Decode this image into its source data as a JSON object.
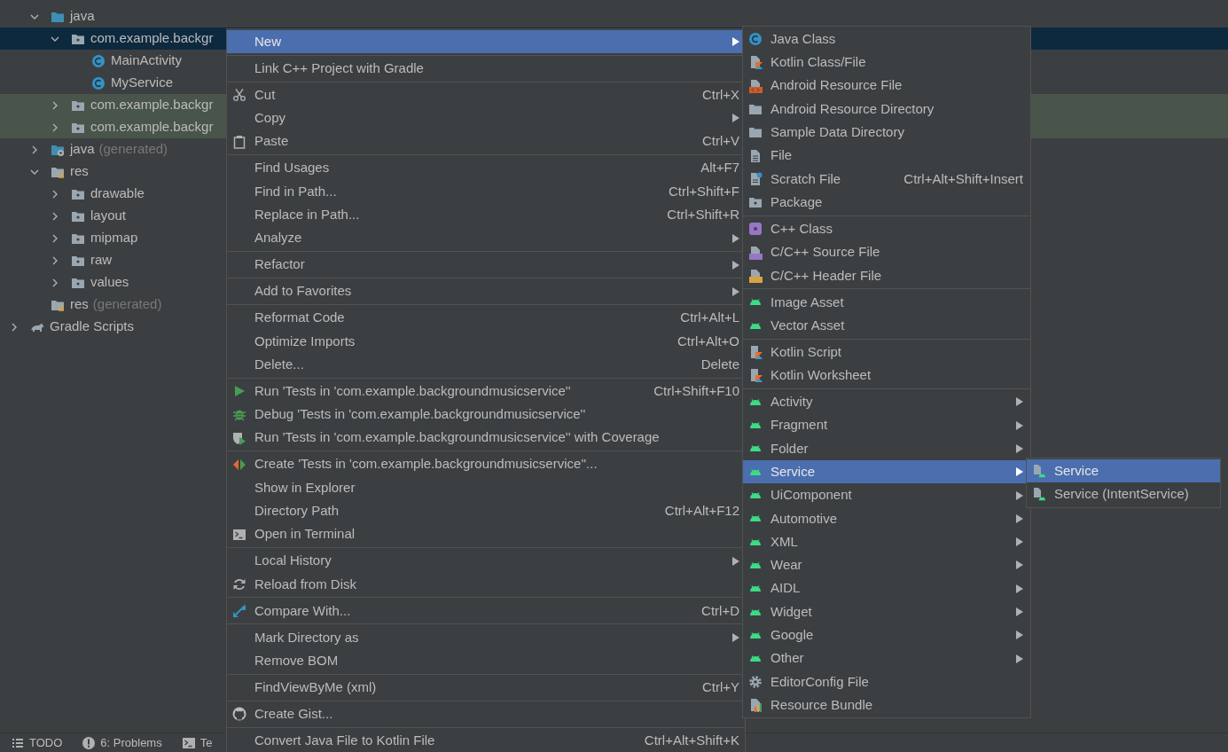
{
  "tree": {
    "items": [
      {
        "label": "java",
        "kind": "source-folder",
        "expanded": true,
        "selected": false,
        "highlighted": false,
        "children": [
          {
            "label": "com.example.backgr",
            "kind": "package",
            "expanded": true,
            "selected": true,
            "highlighted": false,
            "children": [
              {
                "label": "MainActivity",
                "kind": "class",
                "selected": false,
                "highlighted": false
              },
              {
                "label": "MyService",
                "kind": "class",
                "selected": false,
                "highlighted": false
              }
            ]
          },
          {
            "label": "com.example.backgr",
            "kind": "package",
            "expanded": false,
            "selected": false,
            "highlighted": true
          },
          {
            "label": "com.example.backgr",
            "kind": "package",
            "expanded": false,
            "selected": false,
            "highlighted": true
          }
        ]
      },
      {
        "label": "java",
        "note": "(generated)",
        "kind": "generated-folder",
        "expanded": false,
        "selected": false,
        "highlighted": false
      },
      {
        "label": "res",
        "kind": "resource-folder",
        "expanded": true,
        "selected": false,
        "highlighted": false,
        "children": [
          {
            "label": "drawable",
            "kind": "package",
            "expanded": false,
            "selected": false,
            "highlighted": false
          },
          {
            "label": "layout",
            "kind": "package",
            "expanded": false,
            "selected": false,
            "highlighted": false
          },
          {
            "label": "mipmap",
            "kind": "package",
            "expanded": false,
            "selected": false,
            "highlighted": false
          },
          {
            "label": "raw",
            "kind": "package",
            "expanded": false,
            "selected": false,
            "highlighted": false
          },
          {
            "label": "values",
            "kind": "package",
            "expanded": false,
            "selected": false,
            "highlighted": false
          }
        ]
      },
      {
        "label": "res",
        "note": "(generated)",
        "kind": "resource-folder",
        "selected": false,
        "highlighted": false
      }
    ],
    "root_items": [
      {
        "label": "Gradle Scripts",
        "kind": "gradle",
        "expanded": false,
        "selected": false,
        "highlighted": false
      }
    ]
  },
  "tool_window_buttons": [
    {
      "label": "TODO",
      "kind": "todo"
    },
    {
      "label": "6: Problems",
      "kind": "problems"
    },
    {
      "label": "Te",
      "kind": "terminal"
    }
  ],
  "context_menu": {
    "groups": [
      [
        {
          "label": "New",
          "kind": "none",
          "submenu": true,
          "selected": true
        }
      ],
      [
        {
          "label": "Link C++ Project with Gradle",
          "kind": "none",
          "submenu": false,
          "selected": false
        }
      ],
      [
        {
          "label": "Cut",
          "shortcut": "Ctrl+X",
          "kind": "cut",
          "submenu": false,
          "selected": false
        },
        {
          "label": "Copy",
          "kind": "none",
          "submenu": true,
          "selected": false
        },
        {
          "label": "Paste",
          "shortcut": "Ctrl+V",
          "kind": "paste",
          "submenu": false,
          "selected": false
        }
      ],
      [
        {
          "label": "Find Usages",
          "shortcut": "Alt+F7",
          "kind": "none",
          "submenu": false,
          "selected": false
        },
        {
          "label": "Find in Path...",
          "shortcut": "Ctrl+Shift+F",
          "kind": "none",
          "submenu": false,
          "selected": false
        },
        {
          "label": "Replace in Path...",
          "shortcut": "Ctrl+Shift+R",
          "kind": "none",
          "submenu": false,
          "selected": false
        },
        {
          "label": "Analyze",
          "kind": "none",
          "submenu": true,
          "selected": false
        }
      ],
      [
        {
          "label": "Refactor",
          "kind": "none",
          "submenu": true,
          "selected": false
        }
      ],
      [
        {
          "label": "Add to Favorites",
          "kind": "none",
          "submenu": true,
          "selected": false
        }
      ],
      [
        {
          "label": "Reformat Code",
          "shortcut": "Ctrl+Alt+L",
          "kind": "none",
          "submenu": false,
          "selected": false
        },
        {
          "label": "Optimize Imports",
          "shortcut": "Ctrl+Alt+O",
          "kind": "none",
          "submenu": false,
          "selected": false
        },
        {
          "label": "Delete...",
          "shortcut": "Delete",
          "kind": "none",
          "submenu": false,
          "selected": false
        }
      ],
      [
        {
          "label": "Run 'Tests in 'com.example.backgroundmusicservice''",
          "shortcut": "Ctrl+Shift+F10",
          "kind": "run",
          "submenu": false,
          "selected": false
        },
        {
          "label": "Debug 'Tests in 'com.example.backgroundmusicservice''",
          "kind": "debug",
          "submenu": false,
          "selected": false
        },
        {
          "label": "Run 'Tests in 'com.example.backgroundmusicservice'' with Coverage",
          "kind": "coverage",
          "submenu": false,
          "selected": false
        }
      ],
      [
        {
          "label": "Create 'Tests in 'com.example.backgroundmusicservice''...",
          "kind": "create-test",
          "submenu": false,
          "selected": false
        },
        {
          "label": "Show in Explorer",
          "kind": "none",
          "submenu": false,
          "selected": false
        },
        {
          "label": "Directory Path",
          "shortcut": "Ctrl+Alt+F12",
          "kind": "none",
          "submenu": false,
          "selected": false
        },
        {
          "label": "Open in Terminal",
          "kind": "terminal",
          "submenu": false,
          "selected": false
        }
      ],
      [
        {
          "label": "Local History",
          "kind": "none",
          "submenu": true,
          "selected": false
        },
        {
          "label": "Reload from Disk",
          "kind": "reload",
          "submenu": false,
          "selected": false
        }
      ],
      [
        {
          "label": "Compare With...",
          "shortcut": "Ctrl+D",
          "kind": "compare",
          "submenu": false,
          "selected": false
        }
      ],
      [
        {
          "label": "Mark Directory as",
          "kind": "none",
          "submenu": true,
          "selected": false
        },
        {
          "label": "Remove BOM",
          "kind": "none",
          "submenu": false,
          "selected": false
        }
      ],
      [
        {
          "label": "FindViewByMe (xml)",
          "shortcut": "Ctrl+Y",
          "kind": "none",
          "submenu": false,
          "selected": false
        }
      ],
      [
        {
          "label": "Create Gist...",
          "kind": "github",
          "submenu": false,
          "selected": false
        }
      ],
      [
        {
          "label": "Convert Java File to Kotlin File",
          "shortcut": "Ctrl+Alt+Shift+K",
          "kind": "none",
          "submenu": false,
          "selected": false
        }
      ]
    ]
  },
  "new_submenu": {
    "groups": [
      [
        {
          "label": "Java Class",
          "kind": "java-class",
          "submenu": false,
          "selected": false
        },
        {
          "label": "Kotlin Class/File",
          "kind": "kotlin-file",
          "submenu": false,
          "selected": false
        },
        {
          "label": "Android Resource File",
          "kind": "resource-file",
          "submenu": false,
          "selected": false
        },
        {
          "label": "Android Resource Directory",
          "kind": "folder",
          "submenu": false,
          "selected": false
        },
        {
          "label": "Sample Data Directory",
          "kind": "folder",
          "submenu": false,
          "selected": false
        },
        {
          "label": "File",
          "kind": "file",
          "submenu": false,
          "selected": false
        },
        {
          "label": "Scratch File",
          "shortcut": "Ctrl+Alt+Shift+Insert",
          "kind": "scratch",
          "submenu": false,
          "selected": false
        },
        {
          "label": "Package",
          "kind": "package",
          "submenu": false,
          "selected": false
        }
      ],
      [
        {
          "label": "C++ Class",
          "kind": "cpp-class",
          "submenu": false,
          "selected": false
        },
        {
          "label": "C/C++ Source File",
          "kind": "c-source",
          "submenu": false,
          "selected": false
        },
        {
          "label": "C/C++ Header File",
          "kind": "c-header",
          "submenu": false,
          "selected": false
        }
      ],
      [
        {
          "label": "Image Asset",
          "kind": "android",
          "submenu": false,
          "selected": false
        },
        {
          "label": "Vector Asset",
          "kind": "android",
          "submenu": false,
          "selected": false
        }
      ],
      [
        {
          "label": "Kotlin Script",
          "kind": "kotlin-script",
          "submenu": false,
          "selected": false
        },
        {
          "label": "Kotlin Worksheet",
          "kind": "kotlin-script",
          "submenu": false,
          "selected": false
        }
      ],
      [
        {
          "label": "Activity",
          "kind": "android",
          "submenu": true,
          "selected": false
        },
        {
          "label": "Fragment",
          "kind": "android",
          "submenu": true,
          "selected": false
        },
        {
          "label": "Folder",
          "kind": "android",
          "submenu": true,
          "selected": false
        },
        {
          "label": "Service",
          "kind": "android",
          "submenu": true,
          "selected": true
        },
        {
          "label": "UiComponent",
          "kind": "android",
          "submenu": true,
          "selected": false
        },
        {
          "label": "Automotive",
          "kind": "android",
          "submenu": true,
          "selected": false
        },
        {
          "label": "XML",
          "kind": "android",
          "submenu": true,
          "selected": false
        },
        {
          "label": "Wear",
          "kind": "android",
          "submenu": true,
          "selected": false
        },
        {
          "label": "AIDL",
          "kind": "android",
          "submenu": true,
          "selected": false
        },
        {
          "label": "Widget",
          "kind": "android",
          "submenu": true,
          "selected": false
        },
        {
          "label": "Google",
          "kind": "android",
          "submenu": true,
          "selected": false
        },
        {
          "label": "Other",
          "kind": "android",
          "submenu": true,
          "selected": false
        },
        {
          "label": "EditorConfig File",
          "kind": "gear",
          "submenu": false,
          "selected": false
        },
        {
          "label": "Resource Bundle",
          "kind": "resource-bundle",
          "submenu": false,
          "selected": false
        }
      ]
    ]
  },
  "service_submenu": {
    "groups": [
      [
        {
          "label": "Service",
          "kind": "service-file",
          "submenu": false,
          "selected": true
        },
        {
          "label": "Service (IntentService)",
          "kind": "service-file",
          "submenu": false,
          "selected": false
        }
      ]
    ]
  }
}
